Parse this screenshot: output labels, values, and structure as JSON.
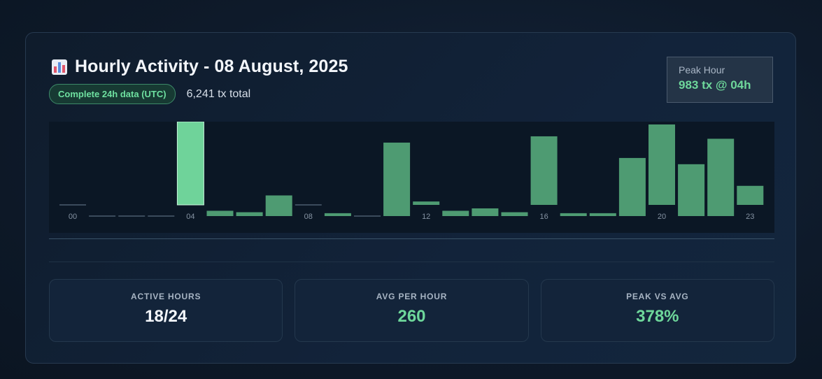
{
  "header": {
    "title": "Hourly Activity - 08 August, 2025",
    "badge": "Complete 24h data (UTC)",
    "total": "6,241 tx total"
  },
  "peak": {
    "label": "Peak Hour",
    "value": "983 tx @ 04h"
  },
  "stats": [
    {
      "label": "ACTIVE HOURS",
      "value": "18/24",
      "color": "#f3f6fb"
    },
    {
      "label": "AVG PER HOUR",
      "value": "260",
      "color": "#6ed79b"
    },
    {
      "label": "PEAK VS AVG",
      "value": "378%",
      "color": "#6ed79b"
    }
  ],
  "colors": {
    "bar": "#4e9b72",
    "peak_bar": "#6fd39a",
    "zero_line": "#3b4b5c",
    "tick": "#8593a3"
  },
  "chart_data": {
    "type": "bar",
    "categories": [
      "00",
      "01",
      "02",
      "03",
      "04",
      "05",
      "06",
      "07",
      "08",
      "09",
      "10",
      "11",
      "12",
      "13",
      "14",
      "15",
      "16",
      "17",
      "18",
      "19",
      "20",
      "21",
      "22",
      "23"
    ],
    "values": [
      0,
      0,
      0,
      0,
      983,
      55,
      40,
      215,
      0,
      30,
      0,
      765,
      40,
      55,
      80,
      40,
      810,
      30,
      30,
      605,
      950,
      540,
      805,
      225
    ],
    "tick_labels": [
      "00",
      "04",
      "08",
      "12",
      "16",
      "20",
      "23"
    ],
    "peak_index": 4
  }
}
